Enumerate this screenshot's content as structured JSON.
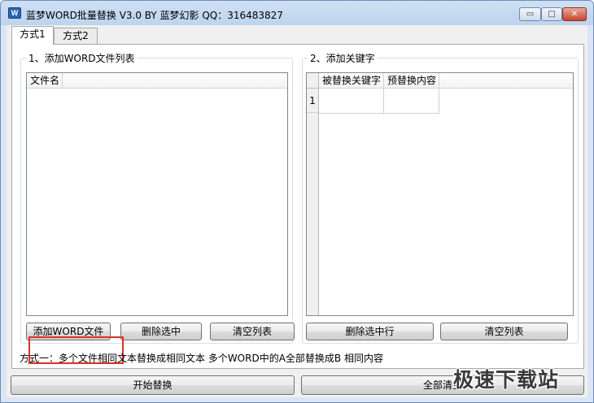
{
  "window": {
    "icon_text": "W",
    "title": "蓝梦WORD批量替换 V3.0 BY 蓝梦幻影 QQ：316483827",
    "min_glyph": "▭",
    "max_glyph": "□",
    "close_glyph": "✕"
  },
  "tabs": [
    {
      "label": "方式1",
      "active": true
    },
    {
      "label": "方式2",
      "active": false
    }
  ],
  "file_group": {
    "title": "1、添加WORD文件列表",
    "column_header": "文件名",
    "buttons": {
      "add": "添加WORD文件",
      "delete": "删除选中",
      "clear": "清空列表"
    }
  },
  "keyword_group": {
    "title": "2、添加关键字",
    "columns": [
      "被替换关键字",
      "预替换内容"
    ],
    "row_numbers": [
      "1"
    ],
    "buttons": {
      "delete_row": "删除选中行",
      "clear": "清空列表"
    }
  },
  "hint_text": "方式一：多个文件相同文本替换成相同文本  多个WORD中的A全部替换成B 相同内容",
  "bottom_buttons": {
    "start": "开始替换",
    "clear_all": "全部清空"
  },
  "watermark": "极速下载站",
  "colors": {
    "highlight_border": "#d9322a",
    "close_button": "#c8452f"
  }
}
